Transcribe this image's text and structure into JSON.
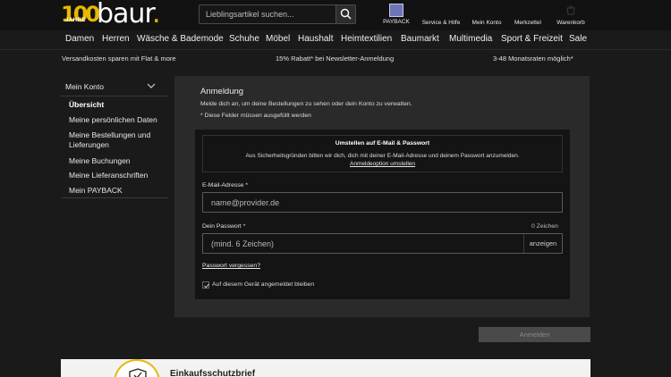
{
  "header": {
    "logo_number": "100",
    "logo_jahre": "JAHRE",
    "logo_word": "baur",
    "logo_dot": ".",
    "search_placeholder": "Lieblingsartikel suchen...",
    "nav": [
      {
        "label": "PAYBACK",
        "icon": "payback-icon"
      },
      {
        "label": "Service & Hilfe",
        "icon": "help-icon"
      },
      {
        "label": "Mein Konto",
        "icon": "user-icon"
      },
      {
        "label": "Merkzettel",
        "icon": "heart-icon"
      },
      {
        "label": "Warenkorb",
        "icon": "cart-icon"
      }
    ]
  },
  "categories": [
    "Damen",
    "Herren",
    "Wäsche & Bademode",
    "Schuhe",
    "Möbel",
    "Haushalt",
    "Heimtextilien",
    "Baumarkt",
    "Multimedia",
    "Sport & Freizeit",
    "Sale"
  ],
  "promo": [
    "Versandkosten sparen mit Flat & more",
    "15% Rabatt* bei Newsletter-Anmeldung",
    "3-48 Monatsraten möglich*"
  ],
  "sidebar": {
    "title": "Mein Konto",
    "items": [
      {
        "label": "Übersicht",
        "active": true
      },
      {
        "label": "Meine persönlichen Daten",
        "active": false
      },
      {
        "label": "Meine Bestellungen und Lieferungen",
        "active": false
      },
      {
        "label": "Meine Buchungen",
        "active": false
      },
      {
        "label": "Meine Lieferanschriften",
        "active": false
      },
      {
        "label": "Mein PAYBACK",
        "active": false
      }
    ]
  },
  "login": {
    "title": "Anmeldung",
    "description": "Melde dich an, um deine Bestellungen zu sehen oder dein Konto zu verwalten.",
    "required_note": "* Diese Felder müssen ausgefüllt werden",
    "notice": {
      "title": "Umstellen auf E-Mail & Passwort",
      "text": "Aus Sicherheitsgründen bitten wir dich, dich mit deiner E-Mail-Adresse und deinem Passwort anzumelden.",
      "link": "Anmeldeoption umstellen"
    },
    "email_label": "E-Mail-Adresse *",
    "email_placeholder": "name@provider.de",
    "email_value": "",
    "password_label": "Dein Passwort *",
    "password_counter": "0 Zeichen",
    "password_placeholder": "(mind. 6 Zeichen)",
    "password_value": "",
    "show_label": "anzeigen",
    "forgot_link": "Passwort vergessen?",
    "remember_label": "Auf diesem Gerät angemeldet bleiben",
    "remember_checked": true,
    "submit_label": "Anmelden"
  },
  "footer_teaser": {
    "title": "Einkaufsschutzbrief"
  },
  "colors": {
    "accent": "#e9b800",
    "background": "#1a1a1a",
    "panel": "#2a2a2a",
    "form": "#141414"
  }
}
